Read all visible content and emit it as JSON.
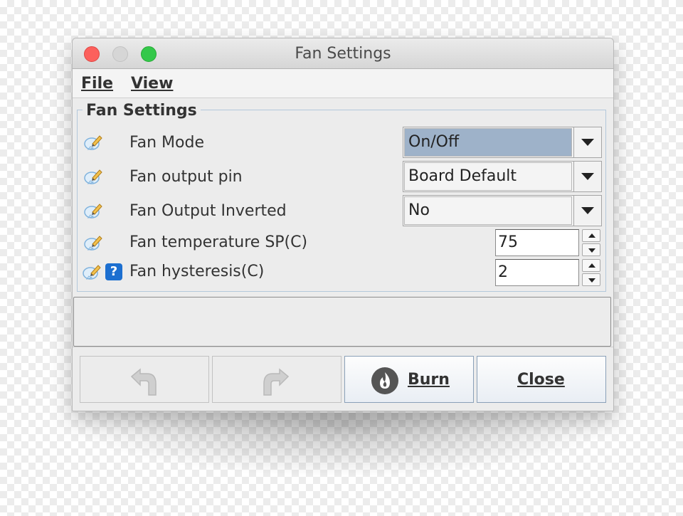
{
  "window": {
    "title": "Fan Settings"
  },
  "menu": [
    {
      "label": "File"
    },
    {
      "label": "View"
    }
  ],
  "panel": {
    "title": "Fan Settings"
  },
  "settings": [
    {
      "label": "Fan Mode",
      "value": "On/Off",
      "control": "dropdown",
      "selected": true
    },
    {
      "label": "Fan output pin",
      "value": "Board Default",
      "control": "dropdown"
    },
    {
      "label": "Fan Output Inverted",
      "value": "No",
      "control": "dropdown"
    },
    {
      "label": "Fan temperature SP(C)",
      "value": "75",
      "control": "spinner"
    },
    {
      "label": "Fan hysteresis(C)",
      "value": "2",
      "control": "spinner",
      "help_icon": "?"
    }
  ],
  "buttons": {
    "undo": {
      "icon": "undo-icon",
      "enabled": false
    },
    "redo": {
      "icon": "redo-icon",
      "enabled": false
    },
    "burn": {
      "label": "Burn",
      "icon": "flame-icon"
    },
    "close": {
      "label": "Close"
    }
  },
  "colors": {
    "close_light": "#fc605c",
    "minimize_light": "#d6d6d6",
    "zoom_light": "#34c84a",
    "selection": "#9eb2c9",
    "help_badge": "#1c6fd0"
  }
}
